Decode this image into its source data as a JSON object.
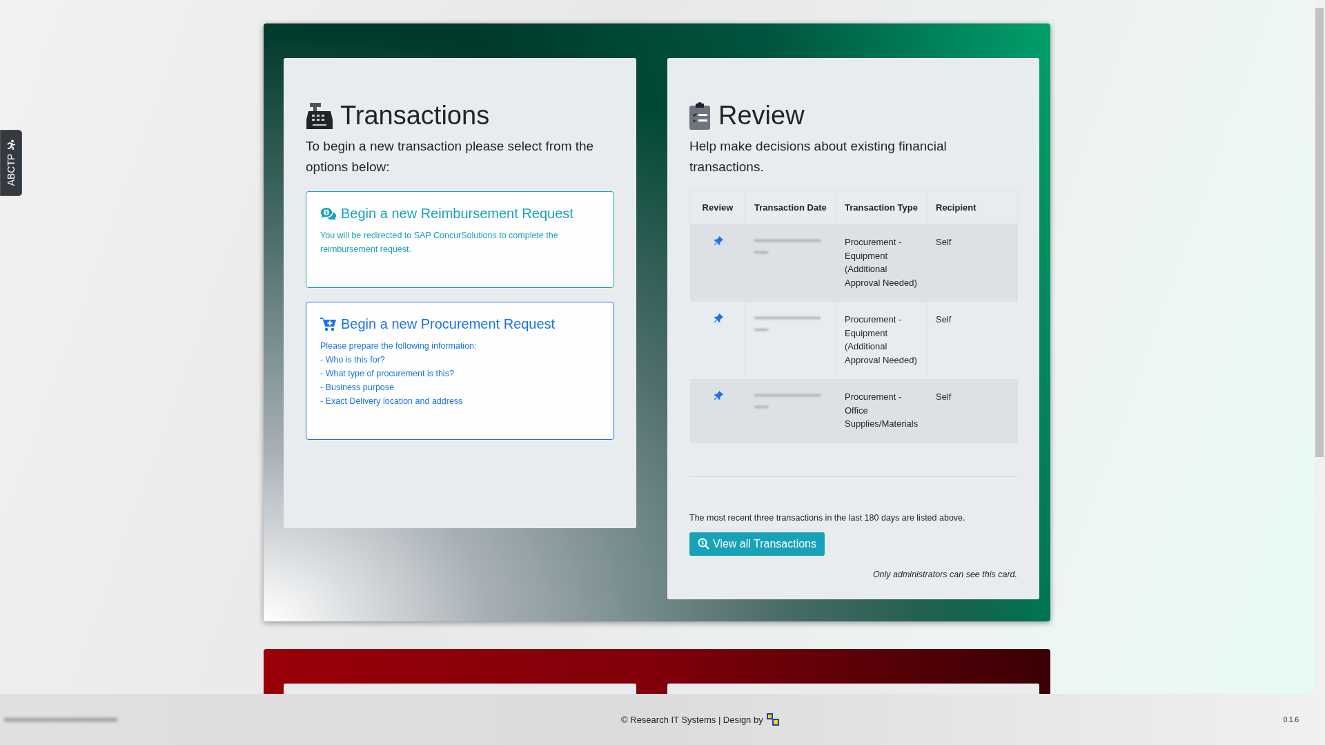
{
  "side_tab": {
    "label": "ABCTP"
  },
  "transactions": {
    "title": "Transactions",
    "intro": "To begin a new transaction please select from the options below:",
    "options": [
      {
        "kind": "reimbursement",
        "title": "Begin a new Reimbursement Request",
        "lines": [
          "You will be redirected to SAP ConcurSolutions to complete the reimbursement request."
        ]
      },
      {
        "kind": "procurement",
        "title": "Begin a new Procurement Request",
        "lines": [
          "Please prepare the following information:",
          "- Who is this for?",
          "- What type of procurement is this?",
          "- Business purpose",
          "- Exact Delivery location and address"
        ]
      }
    ]
  },
  "review": {
    "title": "Review",
    "intro": "Help make decisions about existing financial transactions.",
    "table": {
      "columns": [
        "Review",
        "Transaction Date",
        "Transaction Type",
        "Recipient"
      ],
      "rows": [
        {
          "type": "Procurement - Equipment (Additional Approval Needed)",
          "recipient": "Self"
        },
        {
          "type": "Procurement - Equipment (Additional Approval Needed)",
          "recipient": "Self"
        },
        {
          "type": "Procurement - Office Supplies/Materials",
          "recipient": "Self"
        }
      ]
    },
    "note": "The most recent three transactions in the last 180 days are listed above.",
    "button": "View all Transactions",
    "admin_note": "Only administrators can see this card."
  },
  "footer": {
    "credit": "© Research IT Systems | Design by",
    "version": "0.1.6"
  }
}
